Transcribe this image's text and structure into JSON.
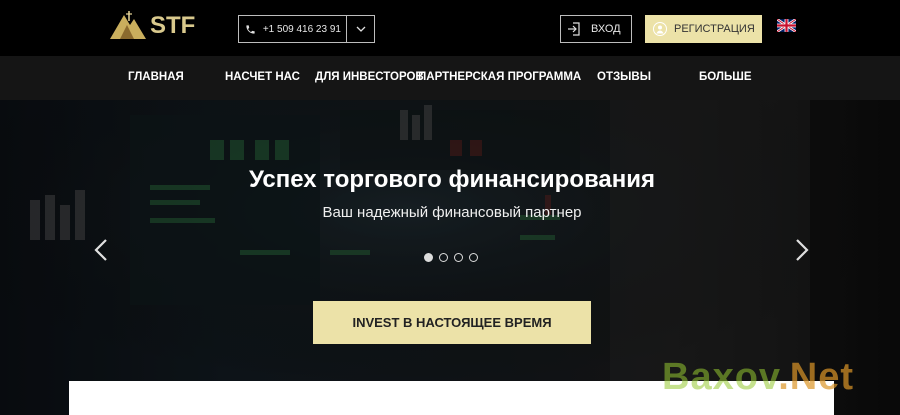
{
  "header": {
    "logo_text": "STF",
    "phone": "+1 509 416 23 91",
    "login_label": "ВХОД",
    "register_label": "РЕГИСТРАЦИЯ",
    "language_flag": "uk-flag-icon"
  },
  "nav": {
    "items": [
      {
        "label": "ГЛАВНАЯ"
      },
      {
        "label": "НАСЧЕТ НАС"
      },
      {
        "label": "ДЛЯ ИНВЕСТОРОВ"
      },
      {
        "label": "ПАРТНЕРСКАЯ ПРОГРАММА"
      },
      {
        "label": "ОТЗЫВЫ"
      },
      {
        "label": "БОЛЬШЕ"
      }
    ]
  },
  "hero": {
    "title": "Успех торгового финансирования",
    "subtitle": "Ваш надежный финансовый партнер",
    "cta_label": "INVEST В НАСТОЯЩЕЕ ВРЕМЯ",
    "slides_total": 4,
    "active_slide": 1
  },
  "watermark": {
    "text_main": "Baxov",
    "text_suffix": ".Net"
  },
  "colors": {
    "accent": "#ece2a8",
    "logo": "#d9c98d",
    "topbar": "#000000",
    "nav": "#151515"
  }
}
